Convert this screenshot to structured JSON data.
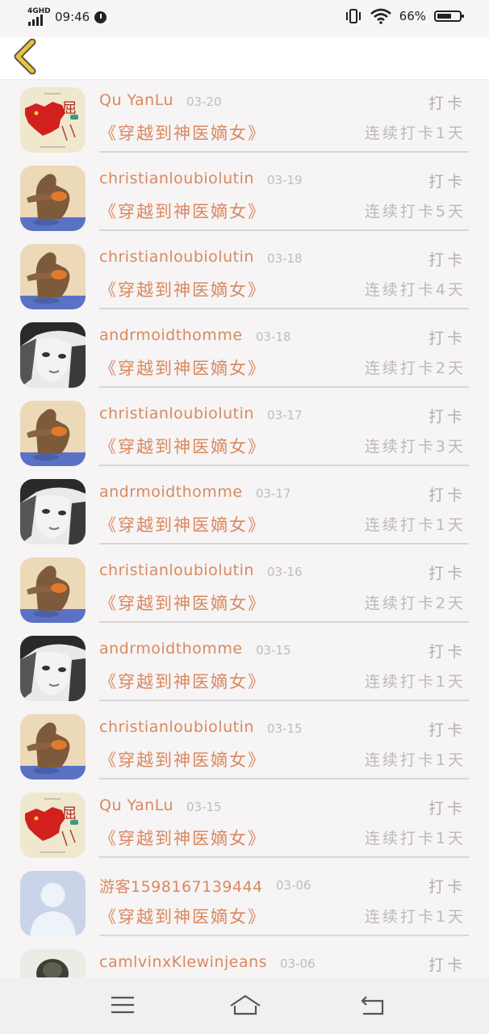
{
  "status": {
    "network": "4GHD",
    "time": "09:46",
    "battery": "66%",
    "battery_level": 0.66
  },
  "records": [
    {
      "user": "Qu YanLu",
      "date": "03-20",
      "action": "打卡",
      "book": "《穿越到神医嫡女》",
      "streak": "连续打卡1天",
      "avatar": "china-map"
    },
    {
      "user": "christianloubiolutin",
      "date": "03-19",
      "action": "打卡",
      "book": "《穿越到神医嫡女》",
      "streak": "连续打卡5天",
      "avatar": "bear"
    },
    {
      "user": "christianloubiolutin",
      "date": "03-18",
      "action": "打卡",
      "book": "《穿越到神医嫡女》",
      "streak": "连续打卡4天",
      "avatar": "bear"
    },
    {
      "user": "andrmoidthomme",
      "date": "03-18",
      "action": "打卡",
      "book": "《穿越到神医嫡女》",
      "streak": "连续打卡2天",
      "avatar": "portrait"
    },
    {
      "user": "christianloubiolutin",
      "date": "03-17",
      "action": "打卡",
      "book": "《穿越到神医嫡女》",
      "streak": "连续打卡3天",
      "avatar": "bear"
    },
    {
      "user": "andrmoidthomme",
      "date": "03-17",
      "action": "打卡",
      "book": "《穿越到神医嫡女》",
      "streak": "连续打卡1天",
      "avatar": "portrait"
    },
    {
      "user": "christianloubiolutin",
      "date": "03-16",
      "action": "打卡",
      "book": "《穿越到神医嫡女》",
      "streak": "连续打卡2天",
      "avatar": "bear"
    },
    {
      "user": "andrmoidthomme",
      "date": "03-15",
      "action": "打卡",
      "book": "《穿越到神医嫡女》",
      "streak": "连续打卡1天",
      "avatar": "portrait"
    },
    {
      "user": "christianloubiolutin",
      "date": "03-15",
      "action": "打卡",
      "book": "《穿越到神医嫡女》",
      "streak": "连续打卡1天",
      "avatar": "bear"
    },
    {
      "user": "Qu YanLu",
      "date": "03-15",
      "action": "打卡",
      "book": "《穿越到神医嫡女》",
      "streak": "连续打卡1天",
      "avatar": "china-map"
    },
    {
      "user": "游客1598167139444",
      "date": "03-06",
      "action": "打卡",
      "book": "《穿越到神医嫡女》",
      "streak": "连续打卡1天",
      "avatar": "default-user"
    },
    {
      "user": "camlvinxKlewinjeans",
      "date": "03-06",
      "action": "打卡",
      "book": "",
      "streak": "",
      "avatar": "plant"
    }
  ],
  "icons": {
    "back": "chevron-left-icon",
    "menu": "menu-icon",
    "home": "home-icon",
    "return": "return-icon"
  },
  "colors": {
    "accent": "#d9895e",
    "back_arrow": "#e7c53c",
    "muted": "#b2aeaf"
  }
}
